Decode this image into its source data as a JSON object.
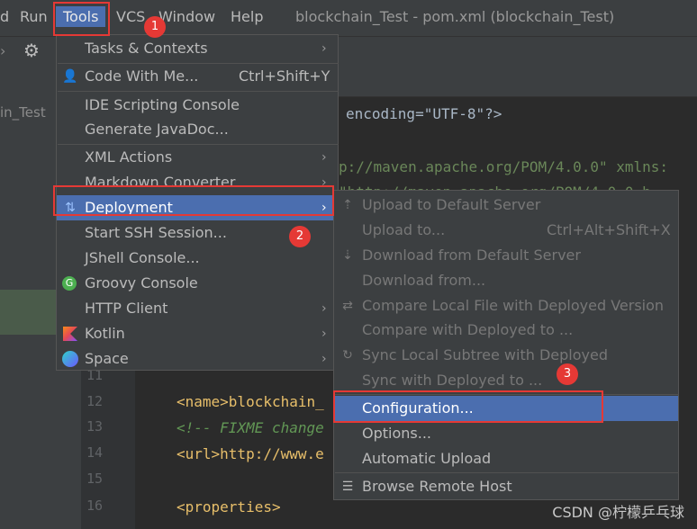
{
  "menubar": {
    "items": [
      "d",
      "Run",
      "Tools",
      "VCS",
      "Window",
      "Help"
    ],
    "title": "blockchain_Test - pom.xml (blockchain_Test)"
  },
  "sidebar": {
    "project_label": "in_Test"
  },
  "editor": {
    "lines": [
      {
        "num": "",
        "code": "encoding=\"UTF-8\"?>"
      },
      {
        "num": "",
        "code": "p://maven.apache.org/POM/4.0.0\" xmlns:"
      },
      {
        "num": "",
        "code": "\"http://maven.apache.org/POM/4.0.0 h"
      },
      {
        "num": "11",
        "code": ""
      },
      {
        "num": "12",
        "code": "<name>blockchain_"
      },
      {
        "num": "13",
        "code": "<!-- FIXME change"
      },
      {
        "num": "14",
        "code": "<url>http://www.e"
      },
      {
        "num": "15",
        "code": ""
      },
      {
        "num": "16",
        "code": "<properties>"
      }
    ]
  },
  "tools_menu": {
    "items": [
      {
        "label": "Tasks & Contexts",
        "submenu": true,
        "icon": ""
      },
      {
        "label": "Code With Me...",
        "shortcut": "Ctrl+Shift+Y",
        "icon": "person-icon"
      },
      {
        "label": "IDE Scripting Console"
      },
      {
        "label": "Generate JavaDoc..."
      },
      {
        "label": "XML Actions",
        "submenu": true
      },
      {
        "label": "Markdown Converter",
        "submenu": true
      },
      {
        "label": "Deployment",
        "submenu": true,
        "icon": "deployment-icon",
        "selected": true
      },
      {
        "label": "Start SSH Session..."
      },
      {
        "label": "JShell Console..."
      },
      {
        "label": "Groovy Console",
        "icon": "groovy-icon"
      },
      {
        "label": "HTTP Client",
        "submenu": true
      },
      {
        "label": "Kotlin",
        "submenu": true,
        "icon": "kotlin-icon"
      },
      {
        "label": "Space",
        "submenu": true,
        "icon": "space-icon"
      }
    ]
  },
  "deployment_menu": {
    "items": [
      {
        "label": "Upload to Default Server",
        "disabled": true,
        "icon": "upload-icon"
      },
      {
        "label": "Upload to...",
        "shortcut": "Ctrl+Alt+Shift+X",
        "disabled": true
      },
      {
        "label": "Download from Default Server",
        "disabled": true,
        "icon": "download-icon"
      },
      {
        "label": "Download from...",
        "disabled": true
      },
      {
        "label": "Compare Local File with Deployed Version",
        "disabled": true,
        "icon": "compare-icon"
      },
      {
        "label": "Compare with Deployed to ...",
        "disabled": true
      },
      {
        "label": "Sync Local Subtree with Deployed",
        "disabled": true,
        "icon": "sync-icon"
      },
      {
        "label": "Sync with Deployed to ...",
        "disabled": true
      },
      {
        "label": "Configuration...",
        "selected": true
      },
      {
        "label": "Options..."
      },
      {
        "label": "Automatic Upload"
      },
      {
        "label": "Browse Remote Host",
        "icon": "browse-icon"
      }
    ]
  },
  "annotations": [
    "1",
    "2",
    "3"
  ],
  "watermark": "CSDN @柠檬乒乓球",
  "colors": {
    "selection": "#4b6eaf",
    "highlight_box": "#e53935",
    "menu_bg": "#3c3f41"
  }
}
